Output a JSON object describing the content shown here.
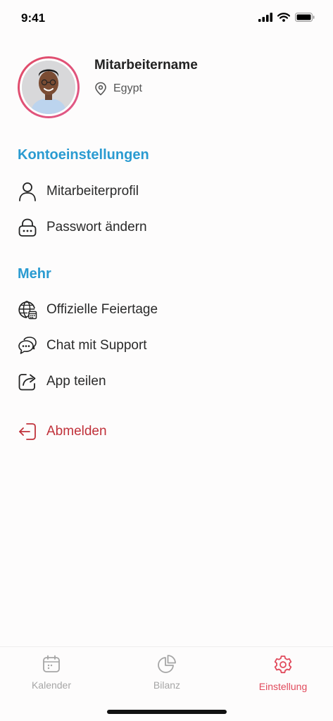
{
  "status_bar": {
    "time": "9:41"
  },
  "profile": {
    "name": "Mitarbeitername",
    "location": "Egypt"
  },
  "sections": {
    "account": {
      "title": "Kontoeinstellungen",
      "items": [
        {
          "label": "Mitarbeiterprofil",
          "icon": "person-icon"
        },
        {
          "label": "Passwort ändern",
          "icon": "lock-icon"
        }
      ]
    },
    "more": {
      "title": "Mehr",
      "items": [
        {
          "label": "Offizielle Feiertage",
          "icon": "globe-calendar-icon"
        },
        {
          "label": "Chat mit Support",
          "icon": "chat-bubbles-icon"
        },
        {
          "label": "App teilen",
          "icon": "share-icon"
        }
      ]
    }
  },
  "logout": {
    "label": "Abmelden",
    "icon": "logout-icon"
  },
  "tab_bar": {
    "tabs": [
      {
        "label": "Kalender",
        "icon": "calendar-icon",
        "active": false
      },
      {
        "label": "Bilanz",
        "icon": "pie-chart-icon",
        "active": false
      },
      {
        "label": "Einstellung",
        "icon": "gear-icon",
        "active": true
      }
    ]
  },
  "colors": {
    "section_title": "#2a9bd1",
    "logout": "#c0313a",
    "active_tab": "#e14a5c",
    "inactive_tab": "#a6a6a6",
    "avatar_ring": "#e04a66"
  }
}
